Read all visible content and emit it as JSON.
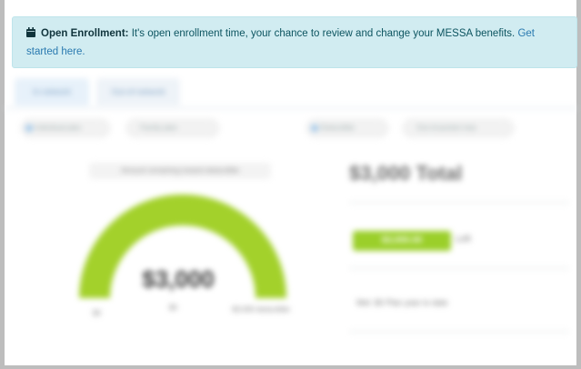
{
  "alert": {
    "title": "Open Enrollment:",
    "message": "It's open enrollment time, your chance to review and change your MESSA benefits.",
    "link_text": "Get started here.",
    "icon": "calendar-icon"
  },
  "tabs": [
    {
      "label": "In-network",
      "active": true
    },
    {
      "label": "Out-of-network",
      "active": false
    }
  ],
  "toggles_left": [
    "Individual plan",
    "Family plan"
  ],
  "toggles_right": [
    "Deductible",
    "Out-of-pocket max"
  ],
  "gauge": {
    "title": "Amount remaining toward deductible",
    "value": "$3,000",
    "fill_fraction": 1.0,
    "left_label": "$0",
    "mid_label": "$0",
    "right_label": "$3,000 deductible",
    "color": "#a3d12b"
  },
  "summary": {
    "title": "$3,000 Total",
    "badge_value": "$3,000.00",
    "badge_suffix": "Left",
    "note": "Met: $0 Plan year to date"
  }
}
